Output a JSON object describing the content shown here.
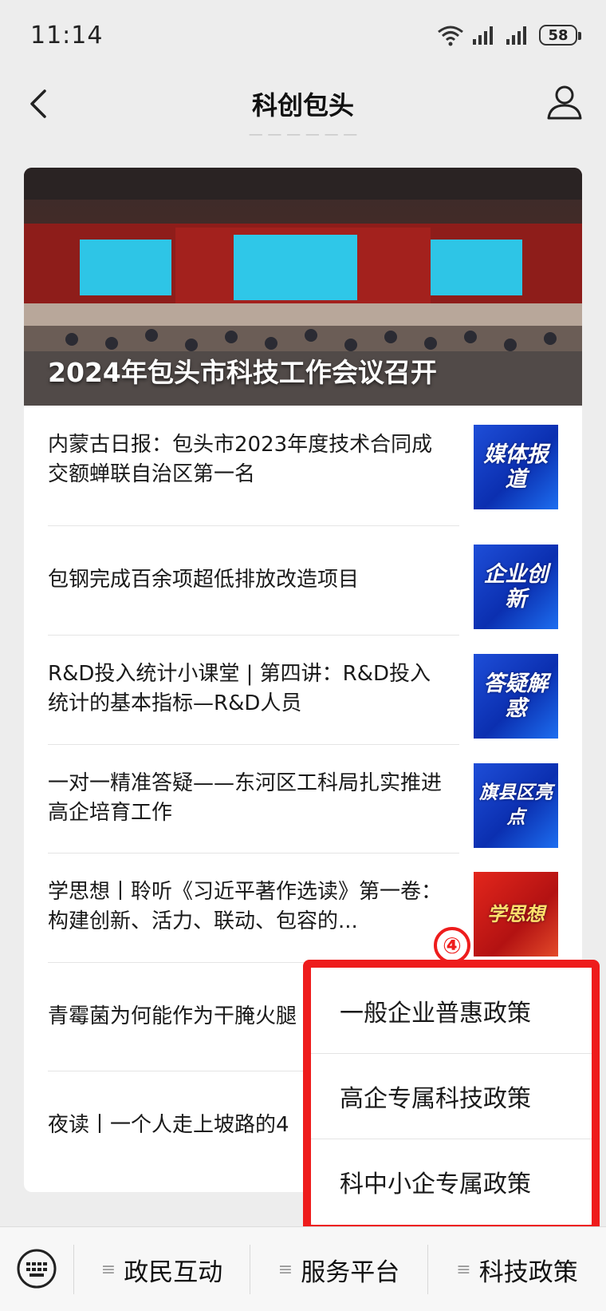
{
  "status_bar": {
    "time": "11:14",
    "battery": "58"
  },
  "nav": {
    "title": "科创包头"
  },
  "hero": {
    "caption": "2024年包头市科技工作会议召开"
  },
  "articles": [
    {
      "title": "内蒙古日报：包头市2023年度技术合同成交额蝉联自治区第一名",
      "thumb": "媒体报道",
      "color": "blue"
    },
    {
      "title": "包钢完成百余项超低排放改造项目",
      "thumb": "企业创新",
      "color": "blue"
    },
    {
      "title": "R&D投入统计小课堂 | 第四讲：R&D投入统计的基本指标—R&D人员",
      "thumb": "答疑解惑",
      "color": "blue"
    },
    {
      "title": "一对一精准答疑——东河区工科局扎实推进高企培育工作",
      "thumb": "旗县区亮点",
      "color": "blue"
    },
    {
      "title": "学思想丨聆听《习近平著作选读》第一卷：构建创新、活力、联动、包容的...",
      "thumb": "学思想",
      "color": "red"
    },
    {
      "title": "青霉菌为何能作为干腌火腿",
      "thumb": "",
      "color": ""
    },
    {
      "title": "夜读丨一个人走上坡路的4",
      "thumb": "",
      "color": ""
    }
  ],
  "step_badge": "④",
  "popup_menu": {
    "items": [
      "一般企业普惠政策",
      "高企专属科技政策",
      "科中小企专属政策"
    ]
  },
  "bottom_menu": {
    "tabs": [
      "政民互动",
      "服务平台",
      "科技政策"
    ]
  },
  "colors": {
    "highlight": "#ee1c1c",
    "thumb_blue": "#1e4ed8",
    "thumb_red": "#d21e15"
  }
}
